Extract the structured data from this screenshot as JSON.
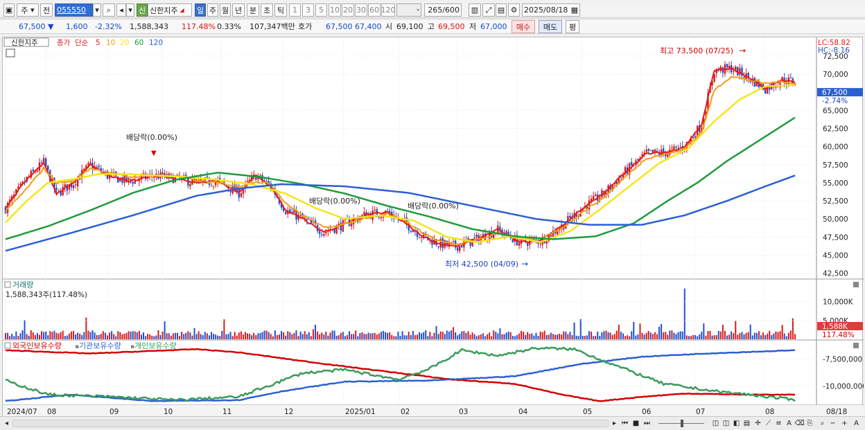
{
  "toolbar": {
    "market_label": "주",
    "prev_label": "전",
    "stock_code": "055550",
    "new_badge": "신",
    "stock_name": "신한지주",
    "periods": [
      "일",
      "주",
      "월",
      "년",
      "분",
      "초",
      "틱"
    ],
    "active_period": "일",
    "minute_options": [
      "1",
      "3",
      "5",
      "10",
      "20",
      "30",
      "60",
      "120"
    ],
    "count_display": "265",
    "count_total": "/600",
    "date": "2025/08/18"
  },
  "quote": {
    "price": "67,500",
    "direction": "▼",
    "change": "1,600",
    "change_rate": "-2.32%",
    "volume": "1,588,343",
    "volume_ratio": "117.48%",
    "turnover": "0.33%",
    "amount": "107,347백만",
    "hoga_label": "호가",
    "ask": "67,500",
    "bid": "67,400",
    "open_label": "시",
    "open": "69,100",
    "high_label": "고",
    "high": "69,500",
    "low_label": "저",
    "low": "67,000",
    "buy_button": "매수",
    "sell_button": "매도",
    "eval_button": "평"
  },
  "price_panel": {
    "name_tag": "신한지주",
    "price_type": "종가",
    "ma_type": "단순",
    "ma_periods": [
      "5",
      "10",
      "20",
      "60",
      "120"
    ],
    "lc_label": "LC:58.82",
    "hc_label": "HC:-8.16",
    "high_annotation": "최고 73,500 (07/25)",
    "low_annotation": "최저 42,500 (04/09)",
    "dividend_label": "배당락(0.00%)",
    "current_price_tag": "67,500",
    "current_change_tag": "-2.74%",
    "y_ticks": [
      "72,500",
      "70,000",
      "65,000",
      "62,500",
      "60,000",
      "57,500",
      "55,000",
      "52,500",
      "50,000",
      "47,500",
      "45,000",
      "42,500"
    ]
  },
  "volume_panel": {
    "title": "거래량",
    "value_label": "1,588,343주(117.48%)",
    "y_ticks": [
      "10,000K",
      "5,000K"
    ],
    "current_tag": "1,588K",
    "current_ratio": "117.48%"
  },
  "holdings_panel": {
    "titles": [
      "외국인보유수량",
      "기관보유수량",
      "개인보유수량"
    ],
    "y_ticks": [
      "-7,500,000",
      "-10,000,000"
    ]
  },
  "x_axis": [
    "2024/07",
    "08",
    "09",
    "10",
    "11",
    "12",
    "2025/01",
    "02",
    "03",
    "04",
    "05",
    "06",
    "07",
    "08",
    "08/18"
  ],
  "colors": {
    "ma5": "#e41a1c",
    "ma10": "#f39c12",
    "ma20": "#f5e51b",
    "ma60": "#1e9b3a",
    "ma120": "#2a5fd6",
    "up": "#d7191c",
    "down": "#1f4fcc",
    "foreign": "#d40000",
    "institution": "#2a5fd6",
    "individual": "#3a9a5a"
  },
  "chart_data": {
    "type": "candlestick",
    "symbol": "신한지주",
    "price_range": [
      41500,
      74000
    ],
    "series": [
      {
        "name": "5",
        "anchors": [
          [
            0,
            51500
          ],
          [
            10,
            55500
          ],
          [
            18,
            57800
          ],
          [
            24,
            53500
          ],
          [
            32,
            55000
          ],
          [
            40,
            57500
          ],
          [
            48,
            56000
          ],
          [
            58,
            55200
          ],
          [
            70,
            56000
          ],
          [
            80,
            55600
          ],
          [
            90,
            55000
          ],
          [
            100,
            55200
          ],
          [
            110,
            53600
          ],
          [
            118,
            56000
          ],
          [
            125,
            54500
          ],
          [
            132,
            51200
          ],
          [
            140,
            50000
          ],
          [
            150,
            48200
          ],
          [
            160,
            49300
          ],
          [
            170,
            50600
          ],
          [
            180,
            50900
          ],
          [
            188,
            49500
          ],
          [
            196,
            47700
          ],
          [
            204,
            46600
          ],
          [
            212,
            46200
          ],
          [
            222,
            47200
          ],
          [
            232,
            48500
          ],
          [
            242,
            46800
          ],
          [
            252,
            47000
          ],
          [
            262,
            49000
          ],
          [
            272,
            51500
          ],
          [
            282,
            53500
          ],
          [
            292,
            56500
          ],
          [
            302,
            59000
          ],
          [
            312,
            59200
          ],
          [
            320,
            60000
          ],
          [
            328,
            63000
          ],
          [
            334,
            70500
          ],
          [
            342,
            70800
          ],
          [
            350,
            69500
          ],
          [
            358,
            68000
          ],
          [
            366,
            69200
          ],
          [
            372,
            68900
          ]
        ]
      },
      {
        "name": "10",
        "anchors": [
          [
            0,
            51000
          ],
          [
            10,
            54200
          ],
          [
            18,
            57000
          ],
          [
            24,
            55000
          ],
          [
            32,
            55200
          ],
          [
            40,
            57000
          ],
          [
            48,
            56500
          ],
          [
            58,
            55800
          ],
          [
            70,
            56000
          ],
          [
            80,
            56000
          ],
          [
            90,
            55300
          ],
          [
            100,
            55000
          ],
          [
            110,
            54500
          ],
          [
            118,
            55200
          ],
          [
            125,
            54800
          ],
          [
            132,
            52200
          ],
          [
            140,
            50500
          ],
          [
            150,
            48800
          ],
          [
            160,
            49300
          ],
          [
            170,
            50200
          ],
          [
            180,
            50700
          ],
          [
            188,
            49800
          ],
          [
            196,
            48200
          ],
          [
            204,
            47000
          ],
          [
            212,
            46400
          ],
          [
            222,
            47100
          ],
          [
            232,
            48000
          ],
          [
            242,
            47300
          ],
          [
            252,
            47200
          ],
          [
            262,
            48700
          ],
          [
            272,
            51000
          ],
          [
            282,
            53000
          ],
          [
            292,
            55800
          ],
          [
            302,
            58400
          ],
          [
            312,
            59000
          ],
          [
            320,
            59700
          ],
          [
            328,
            62000
          ],
          [
            334,
            67800
          ],
          [
            342,
            69700
          ],
          [
            350,
            69200
          ],
          [
            358,
            68700
          ],
          [
            366,
            69000
          ],
          [
            372,
            68700
          ]
        ]
      },
      {
        "name": "20",
        "anchors": [
          [
            0,
            49500
          ],
          [
            10,
            52500
          ],
          [
            20,
            55000
          ],
          [
            32,
            55500
          ],
          [
            44,
            56200
          ],
          [
            58,
            56200
          ],
          [
            70,
            56000
          ],
          [
            84,
            55800
          ],
          [
            100,
            55400
          ],
          [
            116,
            54800
          ],
          [
            132,
            53500
          ],
          [
            146,
            51500
          ],
          [
            160,
            50000
          ],
          [
            176,
            50500
          ],
          [
            192,
            49800
          ],
          [
            208,
            47500
          ],
          [
            222,
            46800
          ],
          [
            238,
            47600
          ],
          [
            252,
            46800
          ],
          [
            266,
            48300
          ],
          [
            280,
            51300
          ],
          [
            294,
            54500
          ],
          [
            308,
            57700
          ],
          [
            322,
            59800
          ],
          [
            334,
            63500
          ],
          [
            346,
            66500
          ],
          [
            358,
            68300
          ],
          [
            372,
            68500
          ]
        ]
      },
      {
        "name": "60",
        "anchors": [
          [
            0,
            47200
          ],
          [
            20,
            49000
          ],
          [
            40,
            51200
          ],
          [
            60,
            53600
          ],
          [
            80,
            55400
          ],
          [
            100,
            56400
          ],
          [
            120,
            55800
          ],
          [
            140,
            54800
          ],
          [
            160,
            53500
          ],
          [
            180,
            51800
          ],
          [
            200,
            50300
          ],
          [
            220,
            48600
          ],
          [
            240,
            47600
          ],
          [
            258,
            47200
          ],
          [
            278,
            47600
          ],
          [
            296,
            49400
          ],
          [
            312,
            52500
          ],
          [
            326,
            55000
          ],
          [
            340,
            58000
          ],
          [
            356,
            61000
          ],
          [
            372,
            64000
          ]
        ]
      },
      {
        "name": "120",
        "anchors": [
          [
            0,
            45600
          ],
          [
            30,
            48000
          ],
          [
            60,
            50500
          ],
          [
            90,
            53200
          ],
          [
            110,
            54200
          ],
          [
            130,
            54800
          ],
          [
            160,
            54500
          ],
          [
            190,
            53600
          ],
          [
            220,
            51800
          ],
          [
            250,
            50000
          ],
          [
            275,
            49200
          ],
          [
            300,
            49200
          ],
          [
            320,
            50500
          ],
          [
            340,
            52500
          ],
          [
            358,
            54500
          ],
          [
            372,
            56000
          ]
        ]
      }
    ],
    "holdings": [
      {
        "name": "외국인보유수량",
        "anchors": [
          [
            0,
            -6700000
          ],
          [
            40,
            -7000000
          ],
          [
            90,
            -6600000
          ],
          [
            110,
            -6900000
          ],
          [
            140,
            -7700000
          ],
          [
            160,
            -8200000
          ],
          [
            210,
            -9400000
          ],
          [
            240,
            -9800000
          ],
          [
            262,
            -10800000
          ],
          [
            280,
            -11400000
          ],
          [
            300,
            -11000000
          ],
          [
            320,
            -10700000
          ],
          [
            350,
            -10800000
          ],
          [
            372,
            -10800000
          ]
        ]
      },
      {
        "name": "기관보유수량",
        "anchors": [
          [
            0,
            -11400000
          ],
          [
            30,
            -10800000
          ],
          [
            70,
            -11400000
          ],
          [
            110,
            -11300000
          ],
          [
            130,
            -10500000
          ],
          [
            160,
            -9600000
          ],
          [
            200,
            -9500000
          ],
          [
            240,
            -9100000
          ],
          [
            270,
            -8000000
          ],
          [
            300,
            -7300000
          ],
          [
            330,
            -7000000
          ],
          [
            372,
            -6700000
          ]
        ]
      },
      {
        "name": "개인보유수량",
        "anchors": [
          [
            0,
            -9500000
          ],
          [
            20,
            -10800000
          ],
          [
            50,
            -11000000
          ],
          [
            80,
            -11300000
          ],
          [
            110,
            -11000000
          ],
          [
            140,
            -8800000
          ],
          [
            160,
            -8500000
          ],
          [
            185,
            -9400000
          ],
          [
            200,
            -8400000
          ],
          [
            215,
            -6700000
          ],
          [
            232,
            -7200000
          ],
          [
            250,
            -6500000
          ],
          [
            268,
            -6600000
          ],
          [
            290,
            -8300000
          ],
          [
            310,
            -9800000
          ],
          [
            335,
            -10500000
          ],
          [
            355,
            -10900000
          ],
          [
            372,
            -11300000
          ]
        ]
      }
    ]
  }
}
